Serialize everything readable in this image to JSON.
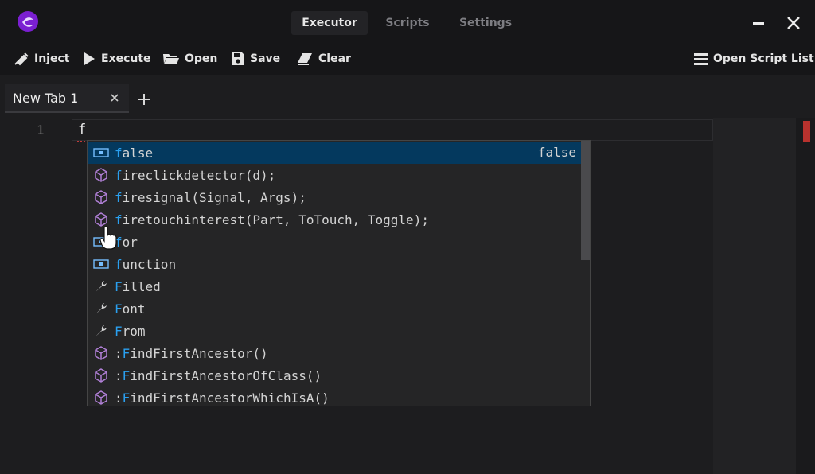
{
  "app": {
    "logo_icon": "electron-logo-icon",
    "accent": "#7b1fd1",
    "nav": [
      {
        "label": "Executor",
        "active": true
      },
      {
        "label": "Scripts",
        "active": false
      },
      {
        "label": "Settings",
        "active": false
      }
    ]
  },
  "toolbar": {
    "inject": "Inject",
    "execute": "Execute",
    "open": "Open",
    "save": "Save",
    "clear": "Clear",
    "open_script_list": "Open Script List"
  },
  "tabs": [
    {
      "label": "New Tab 1"
    }
  ],
  "editor": {
    "line_number": "1",
    "code": "f",
    "error_marker_color": "#b8322e"
  },
  "suggestions": {
    "items": [
      {
        "icon": "keyword-icon",
        "match": "f",
        "rest": "alse",
        "detail": "false",
        "selected": true
      },
      {
        "icon": "method-cube-icon",
        "match": "f",
        "rest": "ireclickdetector(d);"
      },
      {
        "icon": "method-cube-icon",
        "match": "f",
        "rest": "iresignal(Signal, Args);"
      },
      {
        "icon": "method-cube-icon",
        "match": "f",
        "rest": "iretouchinterest(Part, ToTouch, Toggle);"
      },
      {
        "icon": "keyword-icon",
        "match": "f",
        "rest": "or"
      },
      {
        "icon": "keyword-icon",
        "match": "f",
        "rest": "unction"
      },
      {
        "icon": "property-wrench-icon",
        "match": "F",
        "rest": "illed"
      },
      {
        "icon": "property-wrench-icon",
        "match": "F",
        "rest": "ont"
      },
      {
        "icon": "property-wrench-icon",
        "match": "F",
        "rest": "rom"
      },
      {
        "icon": "method-cube-icon",
        "pre": ":",
        "match": "F",
        "rest": "indFirstAncestor()"
      },
      {
        "icon": "method-cube-icon",
        "pre": ":",
        "match": "F",
        "rest": "indFirstAncestorOfClass()"
      },
      {
        "icon": "method-cube-icon",
        "pre": ":",
        "match": "F",
        "rest": "indFirstAncestorWhichIsA()"
      }
    ]
  }
}
